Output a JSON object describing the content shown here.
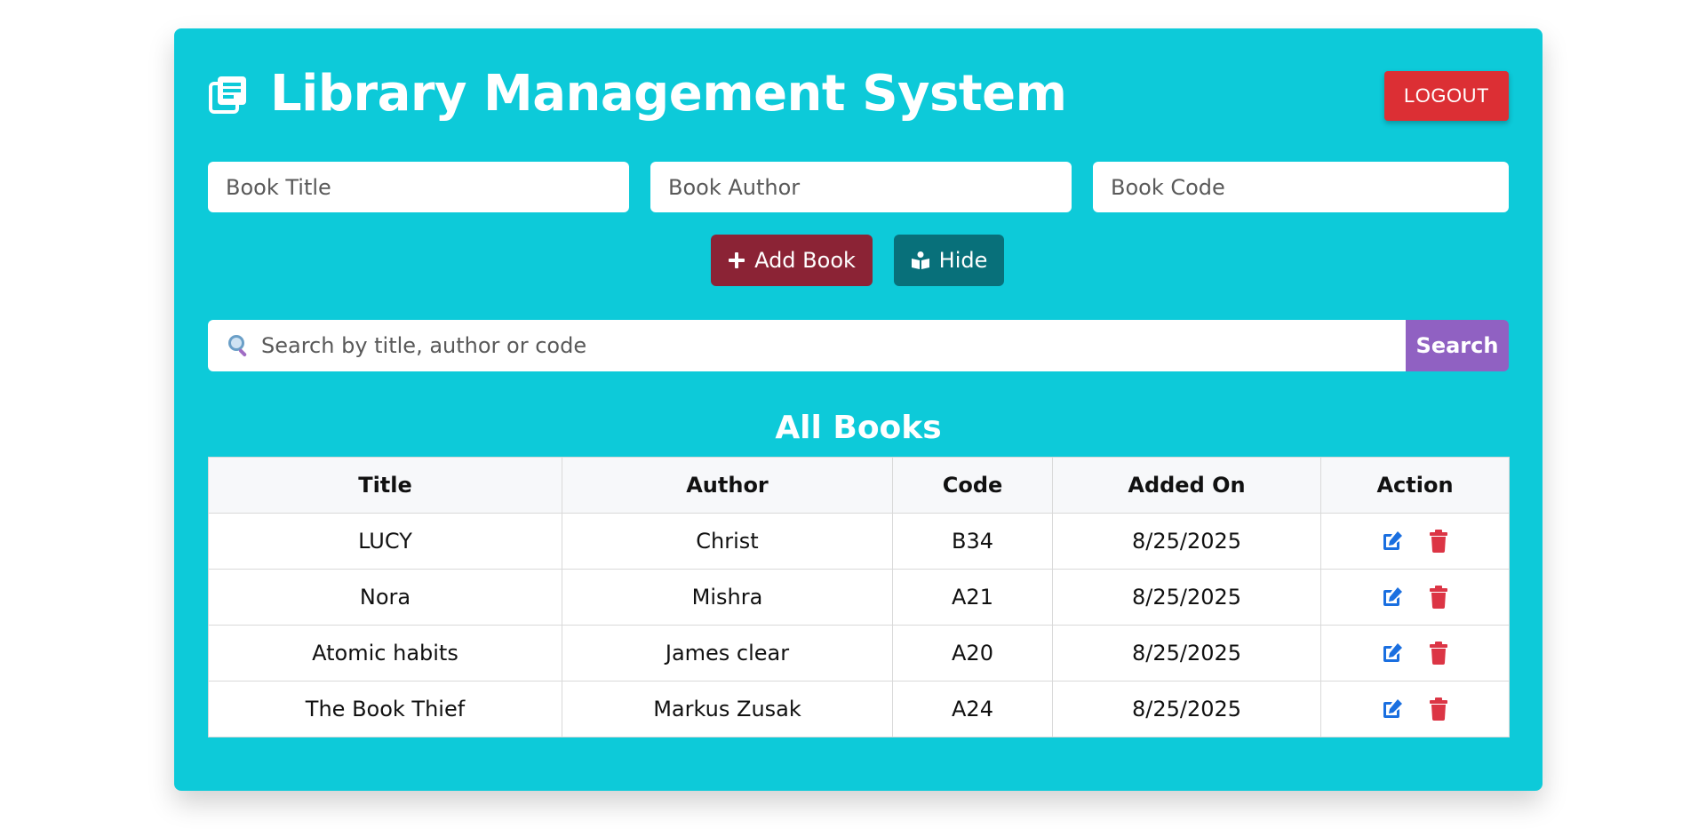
{
  "header": {
    "title": "Library Management System",
    "title_icon": "library-icon",
    "logout_label": "LOGOUT"
  },
  "form": {
    "title_placeholder": "Book Title",
    "author_placeholder": "Book Author",
    "code_placeholder": "Book Code",
    "add_label": "Add Book",
    "add_icon": "plus-icon",
    "hide_label": "Hide",
    "hide_icon": "book-reader-icon"
  },
  "search": {
    "placeholder": "Search by title, author or code",
    "icon": "magnifier-icon",
    "button_label": "Search"
  },
  "books": {
    "heading": "All Books",
    "columns": [
      "Title",
      "Author",
      "Code",
      "Added On",
      "Action"
    ],
    "rows": [
      {
        "title": "LUCY",
        "author": "Christ",
        "code": "B34",
        "added": "8/25/2025"
      },
      {
        "title": "Nora",
        "author": "Mishra",
        "code": "A21",
        "added": "8/25/2025"
      },
      {
        "title": "Atomic habits",
        "author": "James clear",
        "code": "A20",
        "added": "8/25/2025"
      },
      {
        "title": "The Book Thief",
        "author": "Markus Zusak",
        "code": "A24",
        "added": "8/25/2025"
      }
    ],
    "action_icons": [
      "edit-icon",
      "trash-icon"
    ]
  },
  "colors": {
    "panel": "#0dcad9",
    "logout": "#dc2f34",
    "add_button": "#8b2335",
    "hide_button": "#08707a",
    "search_button": "#9061c2",
    "edit": "#1a6fe0",
    "delete": "#dc3545"
  }
}
